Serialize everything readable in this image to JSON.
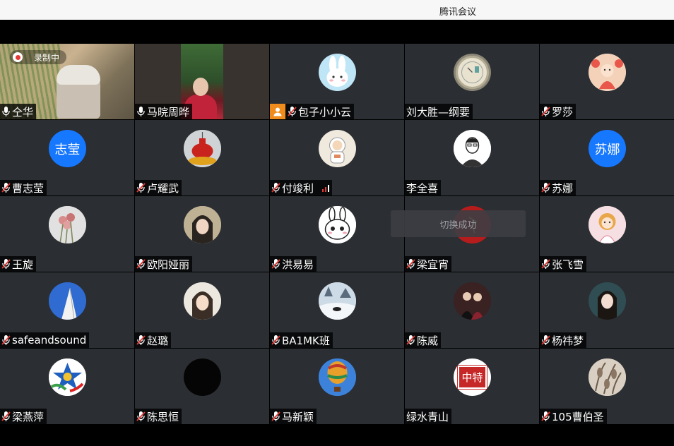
{
  "window": {
    "title": "腾讯会议"
  },
  "recording": {
    "label": "录制中"
  },
  "toast": {
    "text": "切换成功"
  },
  "colors": {
    "accent": "#1677ff",
    "muted_mic": "#e53935",
    "active_border": "#3cb15a",
    "tile_bg": "#2b2e32"
  },
  "participants": [
    {
      "name": "仝华",
      "mic": "on",
      "kind": "video",
      "active": true
    },
    {
      "name": "马晥周晔",
      "mic": "on",
      "kind": "video"
    },
    {
      "name": "包子小小云",
      "mic": "muted",
      "kind": "avatar",
      "avatar_icon": "bunny-avatar-icon",
      "host_badge": true
    },
    {
      "name": "刘大胜—纲要",
      "mic": "none",
      "kind": "avatar",
      "avatar_icon": "clock-avatar-icon"
    },
    {
      "name": "罗莎",
      "mic": "muted",
      "kind": "avatar",
      "avatar_icon": "cartoon-avatar-icon"
    },
    {
      "name": "曹志莹",
      "mic": "muted",
      "kind": "text-avatar",
      "avatar_text": "志莹"
    },
    {
      "name": "卢耀武",
      "mic": "muted",
      "kind": "avatar",
      "avatar_icon": "lantern-avatar-icon"
    },
    {
      "name": "付竣利",
      "mic": "muted",
      "kind": "avatar",
      "avatar_icon": "astronaut-avatar-icon",
      "signal": true
    },
    {
      "name": "李全喜",
      "mic": "none",
      "kind": "avatar",
      "avatar_icon": "sketch-portrait-avatar-icon"
    },
    {
      "name": "苏娜",
      "mic": "muted",
      "kind": "text-avatar",
      "avatar_text": "苏娜"
    },
    {
      "name": "王旋",
      "mic": "muted",
      "kind": "avatar",
      "avatar_icon": "flower-avatar-icon"
    },
    {
      "name": "欧阳娅丽",
      "mic": "muted",
      "kind": "avatar",
      "avatar_icon": "photo-avatar-icon"
    },
    {
      "name": "洪易易",
      "mic": "muted",
      "kind": "avatar",
      "avatar_icon": "bunny-cartoon-avatar-icon"
    },
    {
      "name": "梁宜宵",
      "mic": "muted",
      "kind": "avatar",
      "avatar_icon": "red-avatar-icon"
    },
    {
      "name": "张飞雪",
      "mic": "muted",
      "kind": "avatar",
      "avatar_icon": "girl-cartoon-avatar-icon"
    },
    {
      "name": "safeandsound",
      "mic": "muted",
      "kind": "avatar",
      "avatar_icon": "building-avatar-icon"
    },
    {
      "name": "赵璐",
      "mic": "muted",
      "kind": "avatar",
      "avatar_icon": "photo-avatar-icon"
    },
    {
      "name": "BA1MK班",
      "mic": "muted",
      "kind": "avatar",
      "avatar_icon": "snow-scene-avatar-icon"
    },
    {
      "name": "陈威",
      "mic": "muted",
      "kind": "avatar",
      "avatar_icon": "couple-photo-avatar-icon"
    },
    {
      "name": "杨祎梦",
      "mic": "muted",
      "kind": "avatar",
      "avatar_icon": "portrait-avatar-icon"
    },
    {
      "name": "梁燕萍",
      "mic": "muted",
      "kind": "avatar",
      "avatar_icon": "emblem-avatar-icon"
    },
    {
      "name": "陈思恒",
      "mic": "muted",
      "kind": "avatar",
      "avatar_icon": "black-avatar-icon"
    },
    {
      "name": "马新颖",
      "mic": "muted",
      "kind": "avatar",
      "avatar_icon": "balloon-avatar-icon"
    },
    {
      "name": "绿水青山",
      "mic": "none",
      "kind": "avatar",
      "avatar_icon": "seal-avatar-icon",
      "avatar_text": "中特"
    },
    {
      "name": "105曹伯圣",
      "mic": "muted",
      "kind": "avatar",
      "avatar_icon": "pattern-avatar-icon"
    }
  ]
}
